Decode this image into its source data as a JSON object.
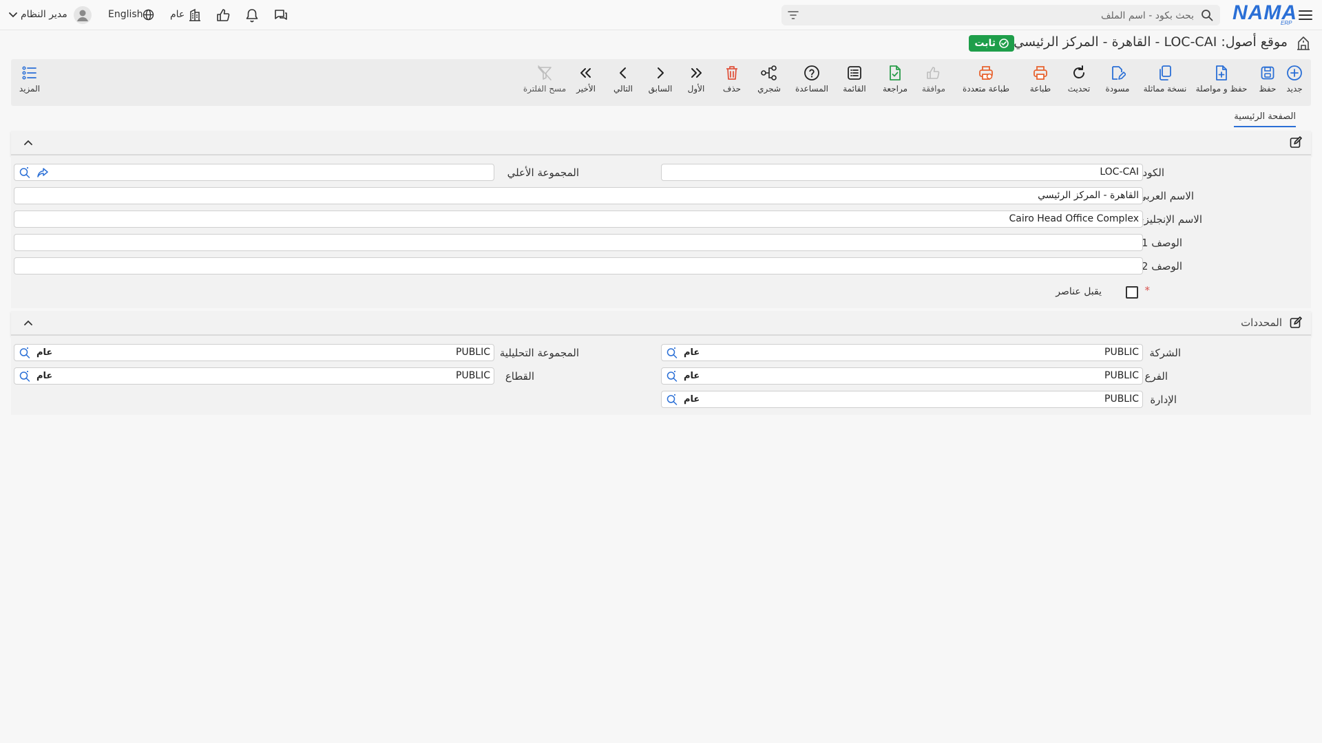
{
  "topbar": {
    "search_placeholder": "بحث بكود - اسم الملف",
    "logo_text": "NAMA",
    "logo_sub": "ERP",
    "user_name": "مدير النظام",
    "language": "English",
    "scope": "عام"
  },
  "title": {
    "text": "موقع أصول: LOC-CAI - القاهرة - المركز الرئيسي",
    "status": "ثابت"
  },
  "toolbar": {
    "new": "جديد",
    "save": "حفظ",
    "save_continue": "حفظ و مواصلة",
    "duplicate": "نسخة مماثلة",
    "draft": "مسودة",
    "refresh": "تحديث",
    "print": "طباعة",
    "multi_print": "طباعة متعددة",
    "approve": "موافقة",
    "review": "مراجعة",
    "list": "القائمة",
    "help": "المساعدة",
    "tree": "شجري",
    "delete": "حذف",
    "first": "الأول",
    "previous": "السابق",
    "next": "التالي",
    "last": "الأخير",
    "clear_filter": "مسح الفلترة",
    "more": "المزيد"
  },
  "tabs": {
    "main": "الصفحة الرئيسية"
  },
  "main_section": {
    "code_label": "الكود",
    "code_value": "LOC-CAI",
    "parent_label": "المجموعة الأعلي",
    "arabic_name_label": "الاسم العربي",
    "arabic_name_value": "القاهرة - المركز الرئيسي",
    "english_name_label": "الاسم الإنجليزي",
    "english_name_value": "Cairo Head Office Complex",
    "desc1_label": "الوصف 1",
    "desc2_label": "الوصف 2",
    "accepts_items_label": "يقبل عناصر",
    "required_mark": "*"
  },
  "dimensions_section": {
    "title": "المحددات",
    "company_label": "الشركة",
    "company_value": "PUBLIC",
    "company_tag": "عام",
    "branch_label": "الفرع",
    "branch_value": "PUBLIC",
    "branch_tag": "عام",
    "department_label": "الإدارة",
    "department_value": "PUBLIC",
    "department_tag": "عام",
    "analytic_label": "المجموعة التحليلية",
    "analytic_value": "PUBLIC",
    "analytic_tag": "عام",
    "sector_label": "القطاع",
    "sector_value": "PUBLIC",
    "sector_tag": "عام"
  },
  "colors": {
    "accent": "#2a6fd6",
    "status_green": "#1e9e4a",
    "danger": "#e0533d",
    "print_orange": "#e8632f"
  }
}
